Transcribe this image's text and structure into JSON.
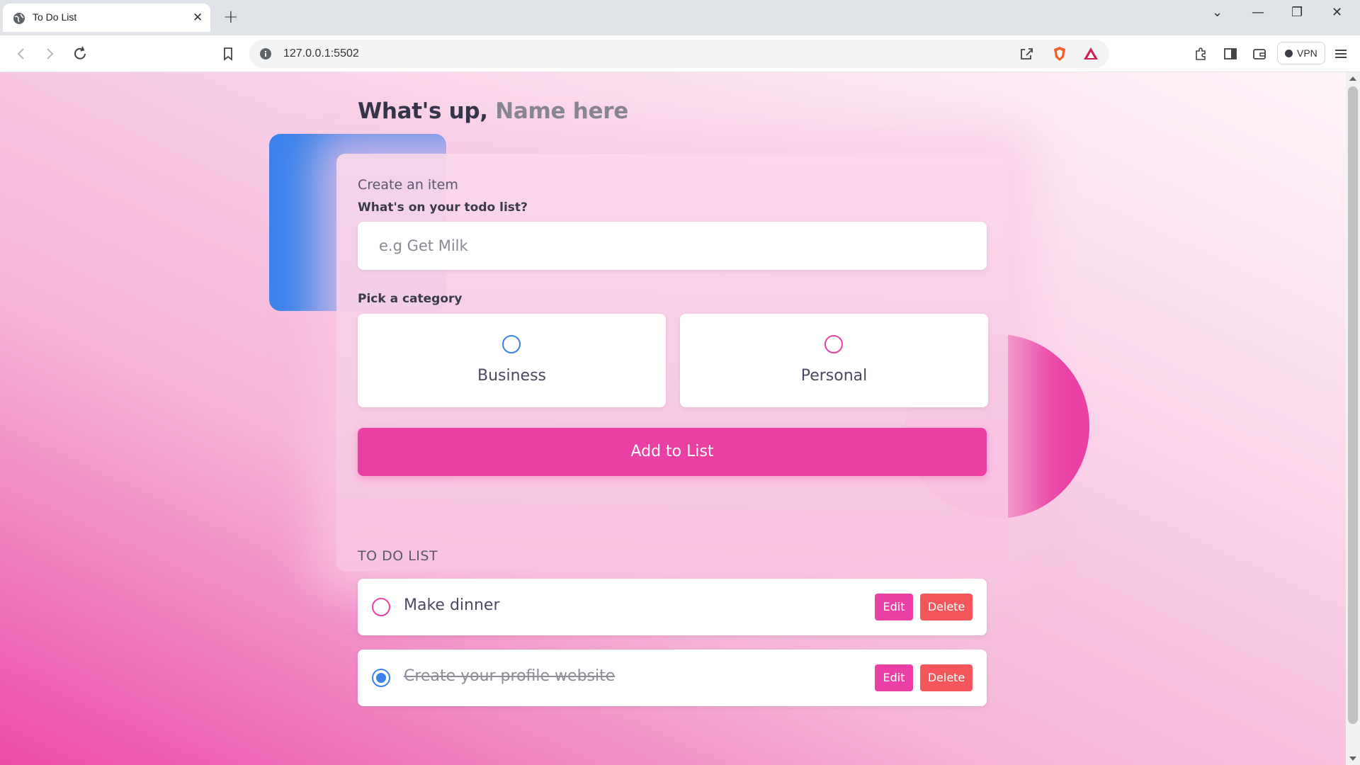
{
  "browser": {
    "tab_title": "To Do List",
    "tab_close": "✕",
    "new_tab": "+",
    "url": "127.0.0.1:5502",
    "vpn_label": "VPN",
    "window_controls": {
      "dropdown": "⌄",
      "minimize": "—",
      "restore": "❐",
      "close": "✕"
    }
  },
  "page": {
    "greeting": "What's up,",
    "name_placeholder": "Name here",
    "create_label": "Create an item",
    "question_label": "What's on your todo list?",
    "input_placeholder": "e.g Get Milk",
    "category_label": "Pick a category",
    "categories": [
      {
        "label": "Business",
        "color": "#3a82ec"
      },
      {
        "label": "Personal",
        "color": "#ea40a4"
      }
    ],
    "add_button": "Add to List",
    "list_title": "TO DO LIST",
    "todos": [
      {
        "text": "Make dinner",
        "done": false,
        "edit": "Edit",
        "delete": "Delete"
      },
      {
        "text": "Create your profile website",
        "done": true,
        "edit": "Edit",
        "delete": "Delete"
      }
    ]
  },
  "colors": {
    "business": "#3a82ec",
    "personal": "#ea40a4",
    "delete": "#f4565b"
  }
}
